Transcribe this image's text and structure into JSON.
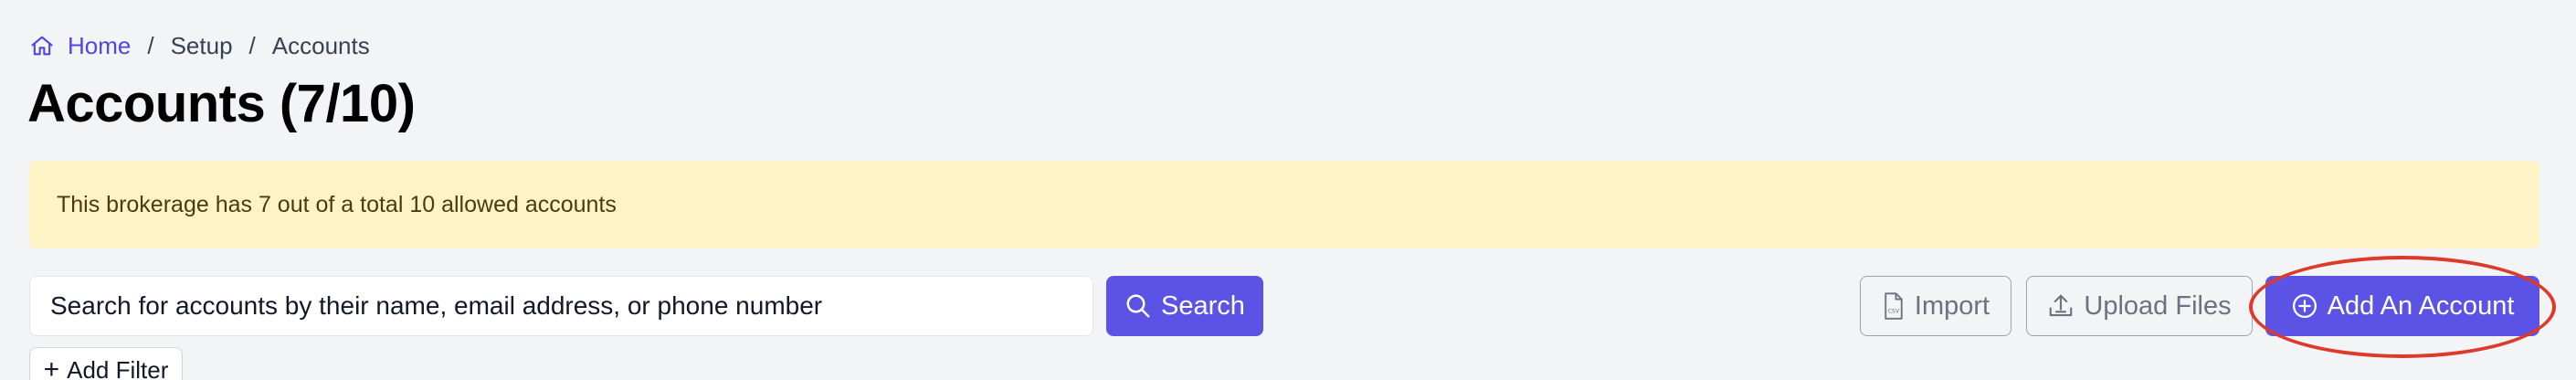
{
  "breadcrumb": {
    "home_icon": "home-icon",
    "home": "Home",
    "separator": "/",
    "setup": "Setup",
    "current": "Accounts"
  },
  "page": {
    "title": "Accounts (7/10)"
  },
  "alert": {
    "message": "This brokerage has 7 out of a total 10 allowed accounts"
  },
  "search": {
    "placeholder": "Search for accounts by their name, email address, or phone number",
    "button_label": "Search",
    "icon": "search-icon"
  },
  "actions": {
    "import_label": "Import",
    "import_icon": "csv-file-icon",
    "upload_label": "Upload Files",
    "upload_icon": "upload-icon",
    "add_label": "Add An Account",
    "add_icon": "plus-circle-icon"
  },
  "filters": {
    "add_filter_label": "Add Filter"
  },
  "colors": {
    "primary": "#5b52e6",
    "link": "#4f46e5",
    "alert_bg": "#fef3c7",
    "highlight": "#dc3b2c"
  }
}
